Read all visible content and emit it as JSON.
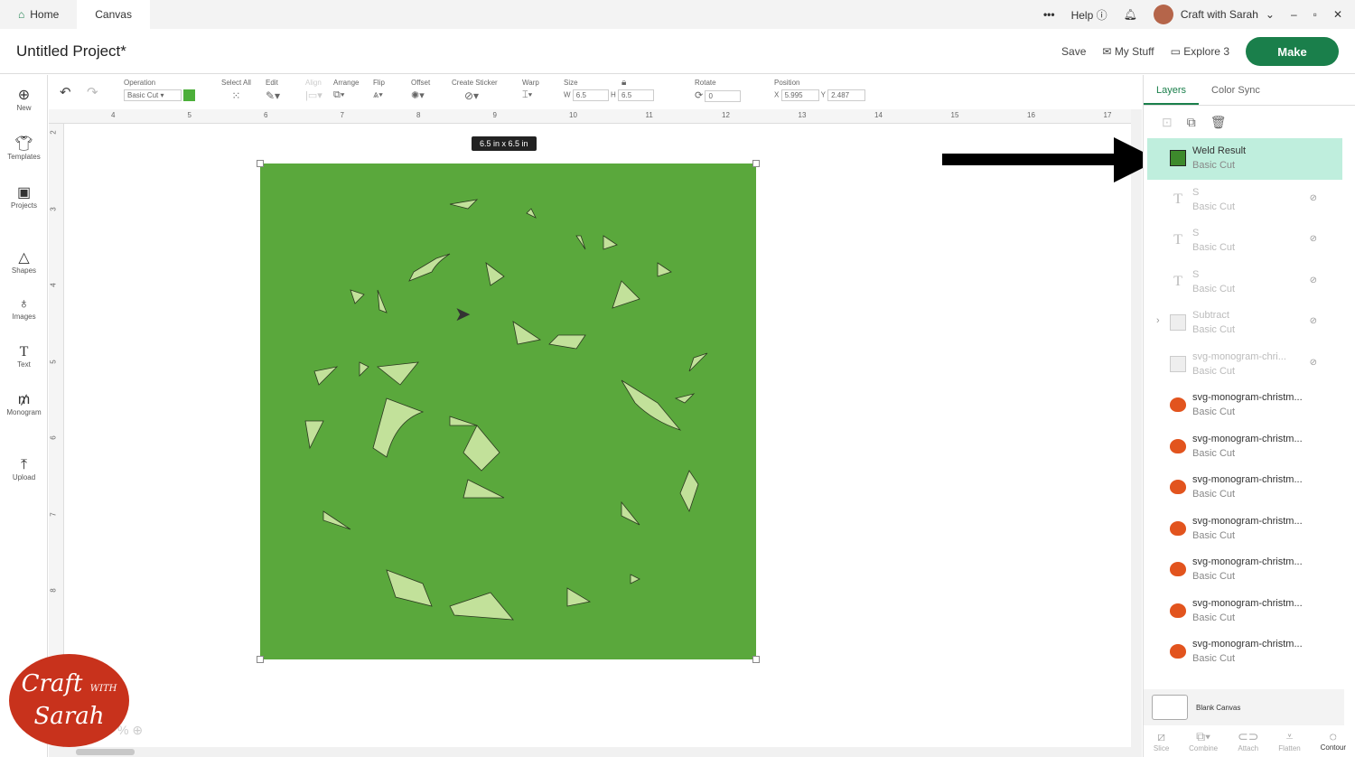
{
  "topbar": {
    "tabs": [
      "Home",
      "Canvas"
    ],
    "help": "Help",
    "account": "Craft with Sarah"
  },
  "header": {
    "title": "Untitled Project*",
    "save": "Save",
    "my_stuff": "My Stuff",
    "explore": "Explore 3",
    "make": "Make"
  },
  "leftnav": [
    "New",
    "Templates",
    "Projects",
    "Shapes",
    "Images",
    "Text",
    "Monogram",
    "Upload"
  ],
  "toolbar": {
    "operation_label": "Operation",
    "operation_value": "Basic Cut",
    "operation_color": "#4caf3a",
    "select_all": "Select All",
    "edit": "Edit",
    "align": "Align",
    "arrange": "Arrange",
    "flip": "Flip",
    "offset": "Offset",
    "create_sticker": "Create Sticker",
    "warp": "Warp",
    "size": "Size",
    "w_label": "W",
    "w": "6.5",
    "h_label": "H",
    "h": "6.5",
    "rotate": "Rotate",
    "rotate_value": "0",
    "position": "Position",
    "x_label": "X",
    "x": "5.995",
    "y_label": "Y",
    "y": "2.487"
  },
  "ruler": {
    "h": [
      "4",
      "5",
      "6",
      "7",
      "8",
      "9",
      "10",
      "11",
      "12",
      "13",
      "14",
      "15",
      "16",
      "17"
    ],
    "v": [
      "2",
      "3",
      "4",
      "5",
      "6",
      "7",
      "8"
    ]
  },
  "canvas": {
    "size_tooltip": "6.5  in x 6.5  in",
    "design_color": "#5aa83c",
    "zoom": "%"
  },
  "panel": {
    "tabs": [
      "Layers",
      "Color Sync"
    ],
    "layers": [
      {
        "name": "Weld Result",
        "op": "Basic Cut",
        "type": "weld",
        "selected": true
      },
      {
        "name": "S",
        "op": "Basic Cut",
        "type": "text",
        "hidden": true
      },
      {
        "name": "S",
        "op": "Basic Cut",
        "type": "text",
        "hidden": true
      },
      {
        "name": "S",
        "op": "Basic Cut",
        "type": "text",
        "hidden": true
      },
      {
        "name": "Subtract",
        "op": "Basic Cut",
        "type": "group",
        "hidden": true
      },
      {
        "name": "svg-monogram-chri...",
        "op": "Basic Cut",
        "type": "image",
        "hidden": true
      },
      {
        "name": "svg-monogram-christm...",
        "op": "Basic Cut",
        "type": "blob"
      },
      {
        "name": "svg-monogram-christm...",
        "op": "Basic Cut",
        "type": "blob"
      },
      {
        "name": "svg-monogram-christm...",
        "op": "Basic Cut",
        "type": "blob"
      },
      {
        "name": "svg-monogram-christm...",
        "op": "Basic Cut",
        "type": "blob"
      },
      {
        "name": "svg-monogram-christm...",
        "op": "Basic Cut",
        "type": "blob"
      },
      {
        "name": "svg-monogram-christm...",
        "op": "Basic Cut",
        "type": "blob"
      },
      {
        "name": "svg-monogram-christm...",
        "op": "Basic Cut",
        "type": "blob"
      }
    ],
    "blank_canvas": "Blank Canvas",
    "actions": [
      "Slice",
      "Combine",
      "Attach",
      "Flatten",
      "Contour"
    ]
  },
  "logo_text": "Craft with Sarah"
}
